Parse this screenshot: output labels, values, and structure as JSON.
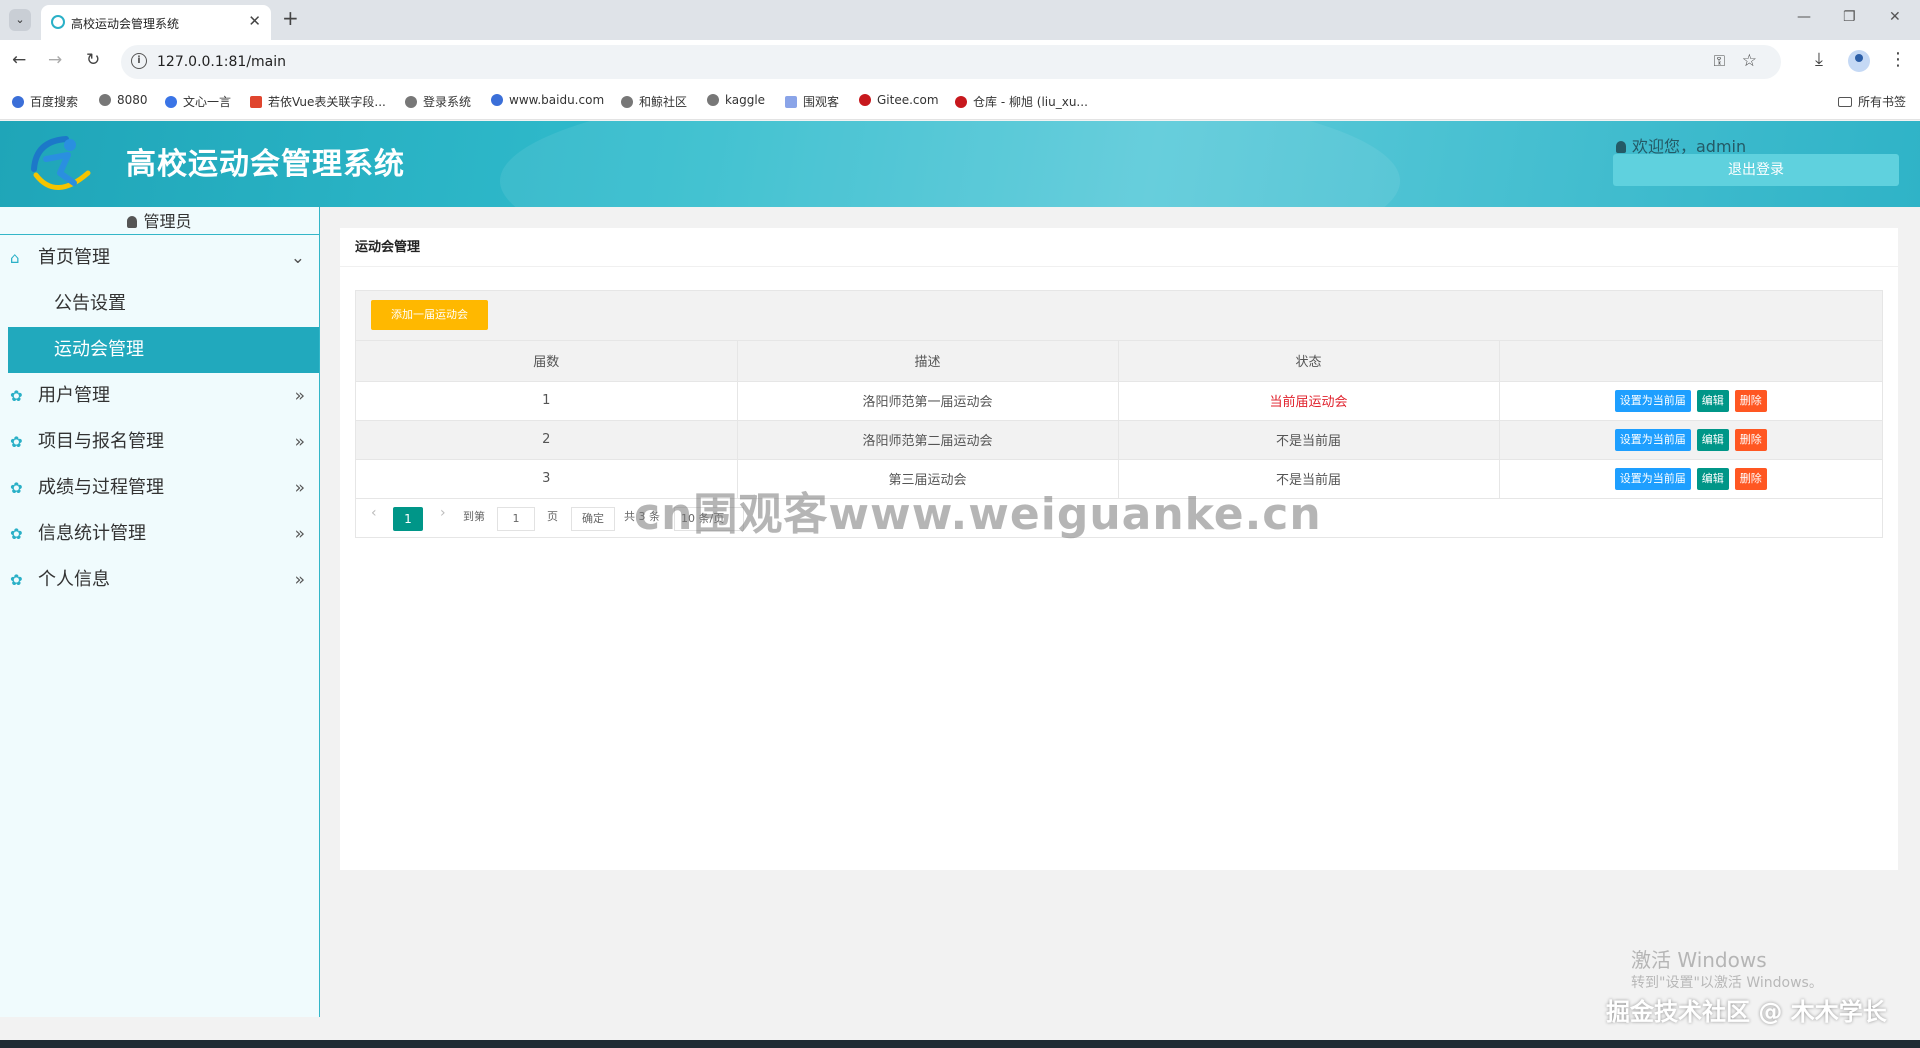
{
  "browser": {
    "tab_title": "高校运动会管理系统",
    "url": "127.0.0.1:81/main",
    "bookmarks": [
      "百度搜索",
      "8080",
      "文心一言",
      "若依Vue表关联字段...",
      "登录系统",
      "www.baidu.com",
      "和鲸社区",
      "kaggle",
      "围观客",
      "Gitee.com",
      "仓库 - 柳旭 (liu_xu..."
    ],
    "all_bookmarks": "所有书签"
  },
  "header": {
    "title": "高校运动会管理系统",
    "welcome": "欢迎您，admin",
    "logout": "退出登录"
  },
  "sidebar": {
    "role": "管理员",
    "menu": [
      {
        "label": "首页管理",
        "icon": "home-icon",
        "expanded": true,
        "children": [
          {
            "label": "公告设置"
          },
          {
            "label": "运动会管理",
            "active": true
          }
        ]
      },
      {
        "label": "用户管理",
        "icon": "gear-icon"
      },
      {
        "label": "项目与报名管理",
        "icon": "gear-icon"
      },
      {
        "label": "成绩与过程管理",
        "icon": "gear-icon"
      },
      {
        "label": "信息统计管理",
        "icon": "gear-icon"
      },
      {
        "label": "个人信息",
        "icon": "gear-icon"
      }
    ]
  },
  "main": {
    "panel_title": "运动会管理",
    "add_button": "添加一届运动会",
    "columns": [
      "届数",
      "描述",
      "状态",
      ""
    ],
    "rows": [
      {
        "num": "1",
        "desc": "洛阳师范第一届运动会",
        "status": "当前届运动会"
      },
      {
        "num": "2",
        "desc": "洛阳师范第二届运动会",
        "status": "不是当前届"
      },
      {
        "num": "3",
        "desc": "第三届运动会",
        "status": "不是当前届"
      }
    ],
    "actions": {
      "set_current": "设置为当前届",
      "edit": "编辑",
      "delete": "删除"
    },
    "pager": {
      "current": "1",
      "goto_label": "到第",
      "page_value": "1",
      "page_suffix": "页",
      "confirm": "确定",
      "total": "共 3 条",
      "per_page": "10 条/页"
    }
  },
  "overlay": {
    "watermark": "cn围观客www.weiguanke.cn",
    "activate_windows": "激活 Windows",
    "activate_windows_sub": "转到\"设置\"以激活 Windows。",
    "juejin": "掘金技术社区 @ 木木学长"
  },
  "colors": {
    "primary": "#21a9bd",
    "add": "#ffb800",
    "set_current": "#1e9fff",
    "edit": "#009688",
    "delete": "#ff5722",
    "current_status": "#e0212c"
  }
}
